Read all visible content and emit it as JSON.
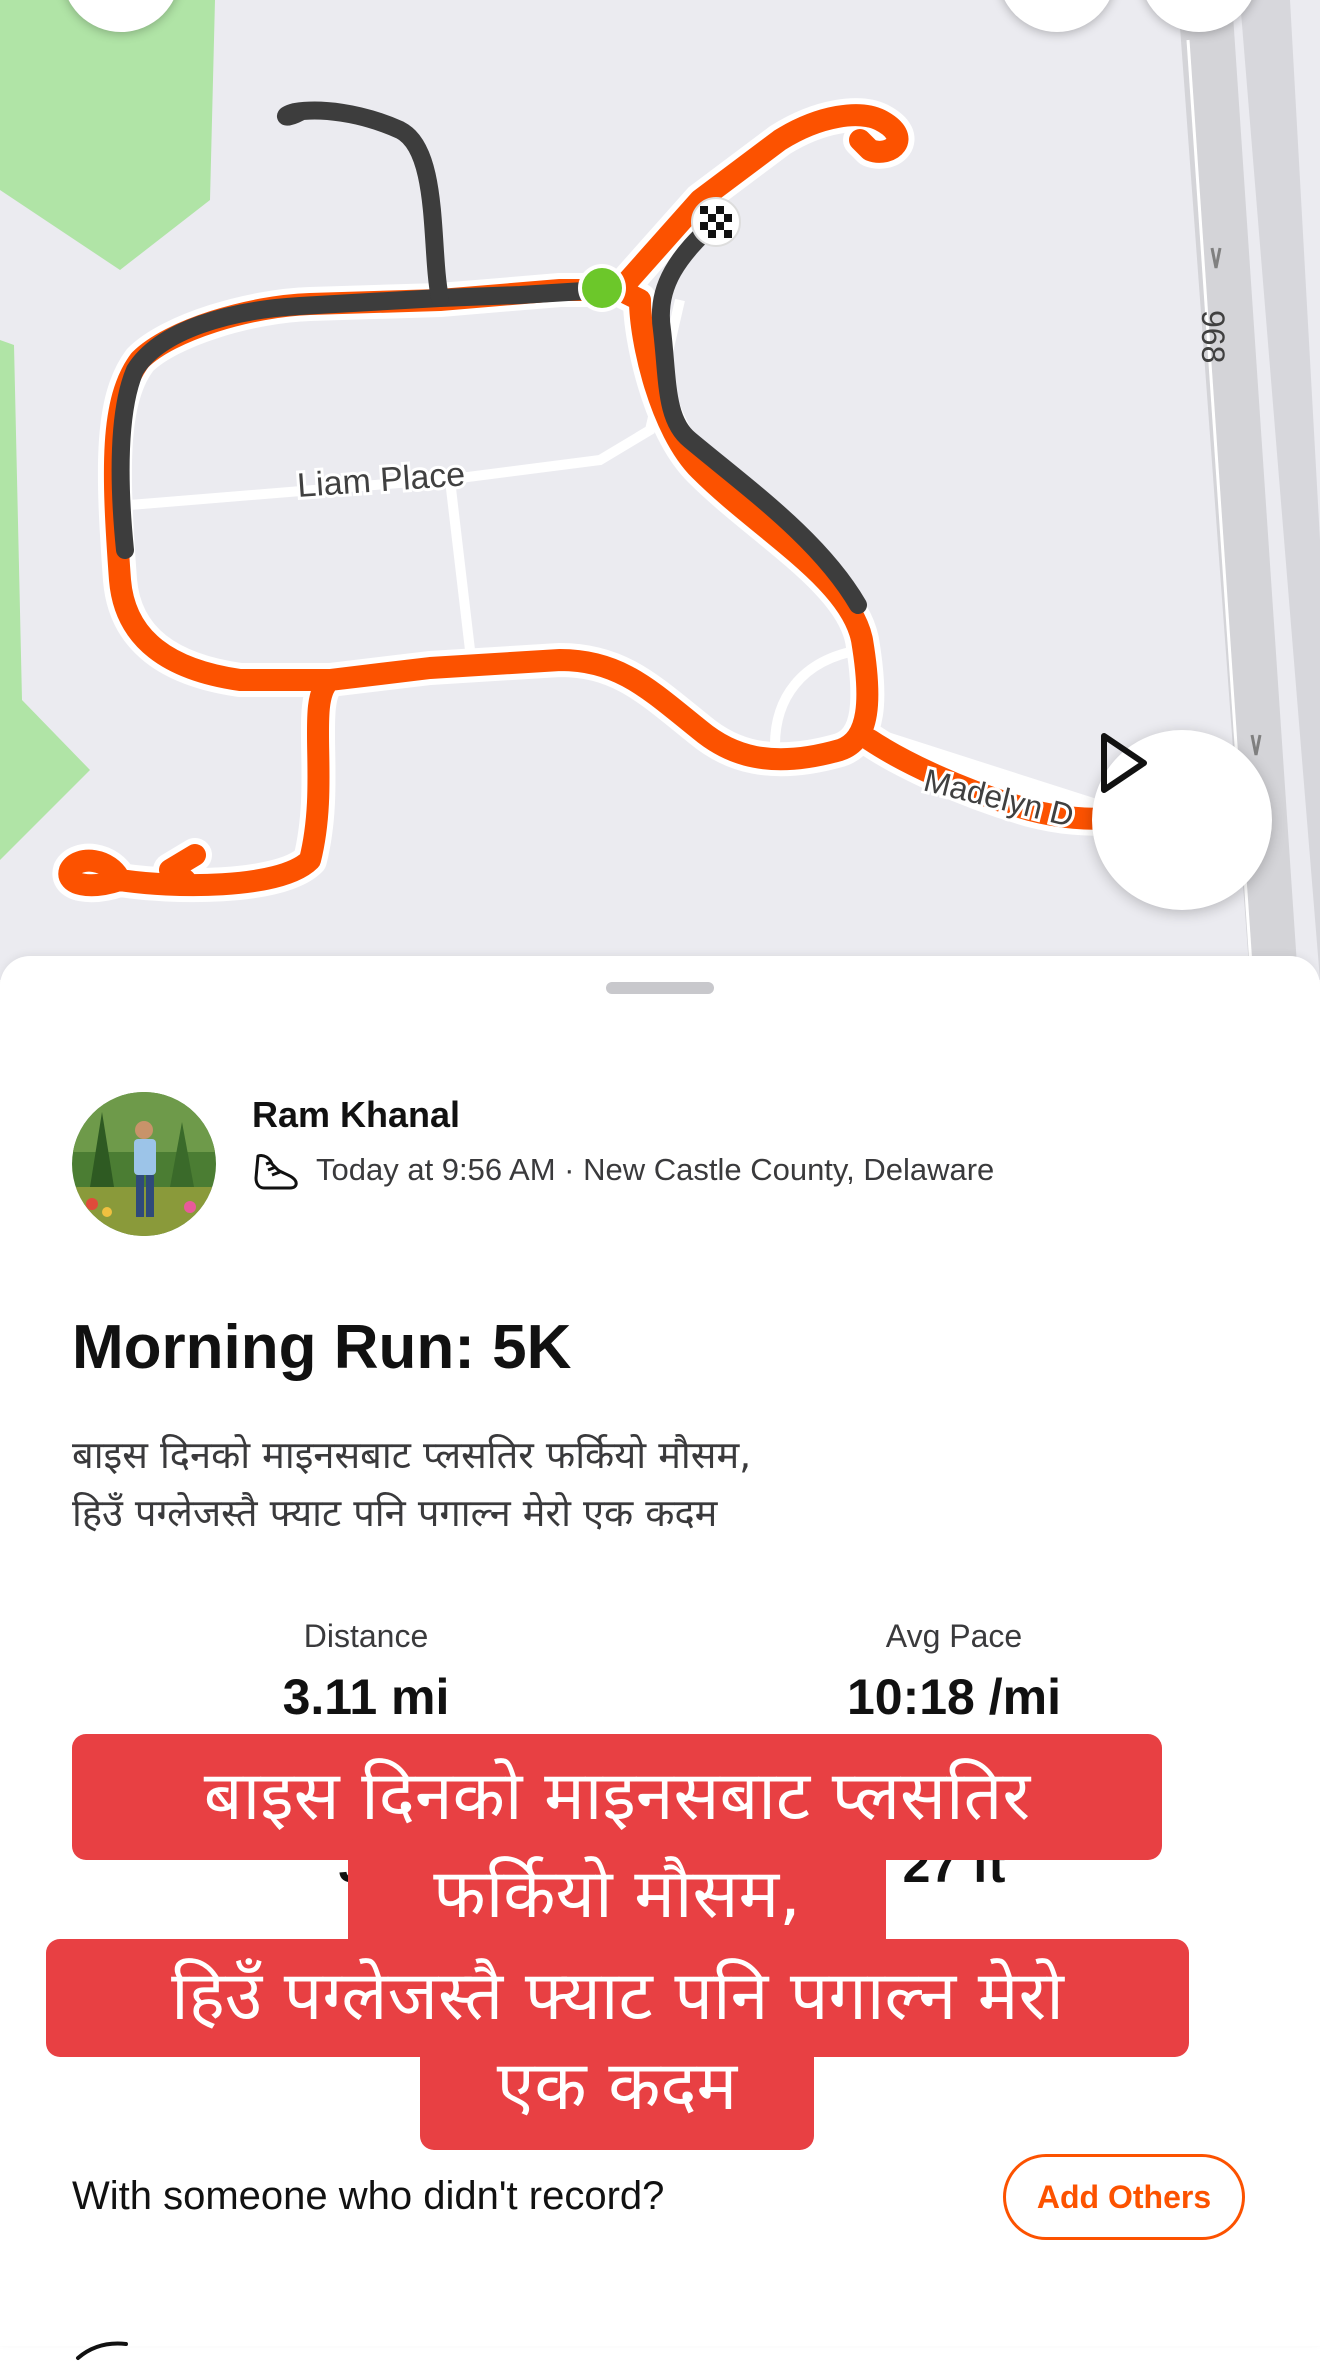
{
  "map": {
    "street_labels": [
      "Liam Place",
      "Madelyn D",
      "968"
    ],
    "route_color": "#fc5200",
    "route_dark_color": "#3d3d3d",
    "start_marker_color": "#6cc72a",
    "icons": [
      "back-icon",
      "share-icon",
      "more-icon",
      "play-icon",
      "finish-flag-icon",
      "start-dot-icon"
    ]
  },
  "athlete": {
    "name": "Ram Khanal",
    "meta": "Today at 9:56 AM · New Castle County, Delaware",
    "sport_icon": "running-shoe-icon"
  },
  "activity": {
    "title": "Morning Run: 5K",
    "description_lines": [
      "बाइस दिनको माइनसबाट प्लसतिर फर्कियो मौसम,",
      "हिउँ पग्लेजस्तै फ्याट पनि पगाल्न मेरो एक कदम"
    ]
  },
  "stats": [
    {
      "label": "Distance",
      "value": "3.11 mi"
    },
    {
      "label": "Avg Pace",
      "value": "10:18 /mi"
    },
    {
      "label": "",
      "value": "32"
    },
    {
      "label": "",
      "value": "27 ft"
    }
  ],
  "caption_overlay": {
    "lines": [
      "बाइस दिनको माइनसबाट प्लसतिर",
      "फर्कियो मौसम,",
      "हिउँ पग्लेजस्तै फ्याट पनि पगाल्न मेरो",
      "एक कदम"
    ],
    "background": "#e84043"
  },
  "partners": {
    "question": "With someone who didn't record?",
    "button_label": "Add Others"
  },
  "accent": "#fc5200"
}
